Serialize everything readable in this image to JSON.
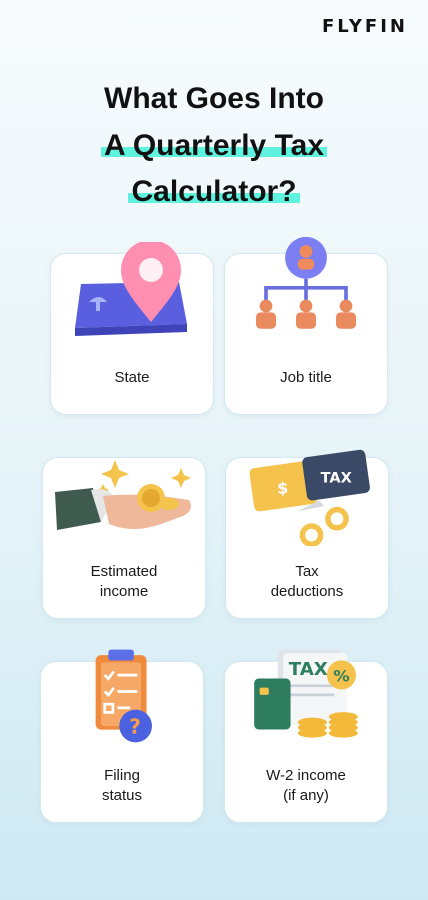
{
  "brand": "FLYFIN",
  "title": {
    "line1": "What Goes Into",
    "line2": "A Quarterly Tax",
    "line3": "Calculator?"
  },
  "cards": [
    {
      "label": [
        "State"
      ],
      "icon": "location-pin-icon"
    },
    {
      "label": [
        "Job title"
      ],
      "icon": "org-chart-icon"
    },
    {
      "label": [
        "Estimated",
        "income"
      ],
      "icon": "hand-coins-icon"
    },
    {
      "label": [
        "Tax",
        "deductions"
      ],
      "icon": "scissors-tax-card-icon"
    },
    {
      "label": [
        "Filing",
        "status"
      ],
      "icon": "clipboard-question-icon"
    },
    {
      "label": [
        "W-2 income",
        "(if any)"
      ],
      "icon": "tax-document-coins-icon"
    }
  ],
  "art_text": {
    "tax_tag": "TAX",
    "dollar": "$",
    "question": "?",
    "tax_doc": "TAX",
    "percent": "%"
  },
  "colors": {
    "accent_highlight": "#5ef2df",
    "card_border": "#d4e8ef"
  }
}
